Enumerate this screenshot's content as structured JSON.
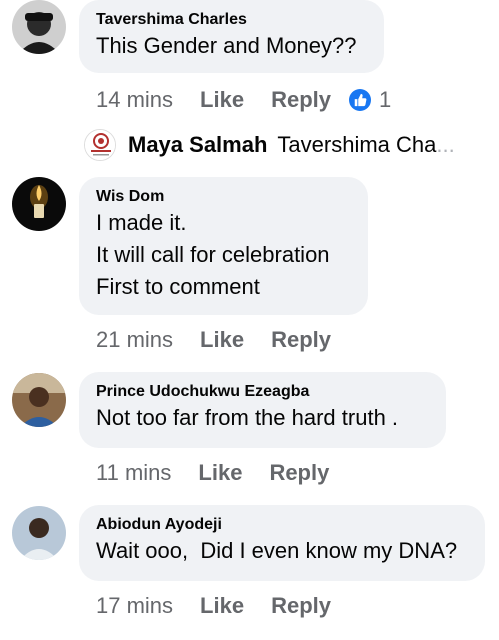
{
  "comments": [
    {
      "author": "Tavershima Charles",
      "lines": [
        "This Gender and Money??"
      ],
      "time": "14 mins",
      "like_label": "Like",
      "reply_label": "Reply",
      "reaction_count": "1",
      "avatar_icon": "person-with-cap-avatar"
    },
    {
      "author": "Wis Dom",
      "lines": [
        "I made it.",
        "It will call for celebration",
        "First to comment"
      ],
      "time": "21 mins",
      "like_label": "Like",
      "reply_label": "Reply",
      "avatar_icon": "candle-avatar"
    },
    {
      "author": "Prince Udochukwu Ezeagba",
      "lines": [
        "Not too far from the hard truth ."
      ],
      "time": "11 mins",
      "like_label": "Like",
      "reply_label": "Reply",
      "avatar_icon": "person-avatar"
    },
    {
      "author": "Abiodun Ayodeji",
      "lines": [
        "Wait ooo,  Did I even know my DNA?"
      ],
      "time": "17 mins",
      "like_label": "Like",
      "reply_label": "Reply",
      "avatar_icon": "person-avatar"
    }
  ],
  "reply_preview": {
    "author": "Maya Salmah",
    "text": "Tavershima Cha",
    "ellipsis": "...",
    "avatar_icon": "logo-badge-avatar"
  },
  "colors": {
    "bubble": "#f0f2f5",
    "meta": "#65676b",
    "like_blue": "#1877f2"
  }
}
